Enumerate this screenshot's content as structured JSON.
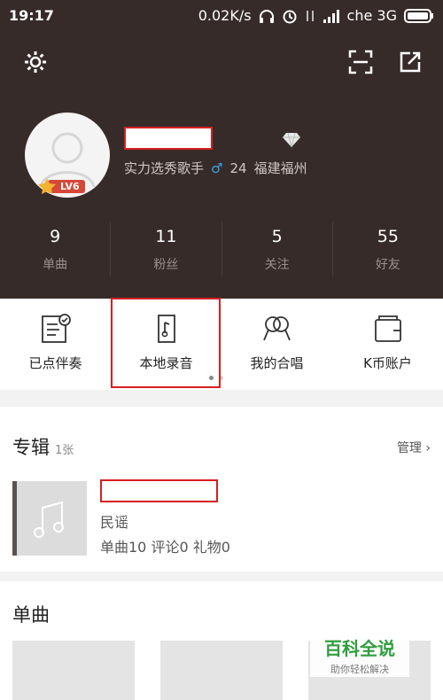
{
  "status_bar": {
    "time": "19:17",
    "speed": "0.02K/s",
    "carrier": "che 3G"
  },
  "profile": {
    "title": "实力选秀歌手",
    "age": "24",
    "location": "福建福州",
    "level": "LV6"
  },
  "stats": [
    {
      "num": "9",
      "label": "单曲"
    },
    {
      "num": "11",
      "label": "粉丝"
    },
    {
      "num": "5",
      "label": "关注"
    },
    {
      "num": "55",
      "label": "好友"
    }
  ],
  "quick_actions": [
    {
      "label": "已点伴奏",
      "icon": "accompaniment-list-icon"
    },
    {
      "label": "本地录音",
      "icon": "local-recording-icon"
    },
    {
      "label": "我的合唱",
      "icon": "chorus-icon"
    },
    {
      "label": "K币账户",
      "icon": "wallet-icon"
    }
  ],
  "album_section": {
    "title": "专辑",
    "count": "1张",
    "manage": "管理",
    "genre": "民谣",
    "meta": "单曲10 评论0 礼物0"
  },
  "singles_section": {
    "title": "单曲"
  },
  "watermark": {
    "line1": "百科全说",
    "line2": "助你轻松解决"
  }
}
